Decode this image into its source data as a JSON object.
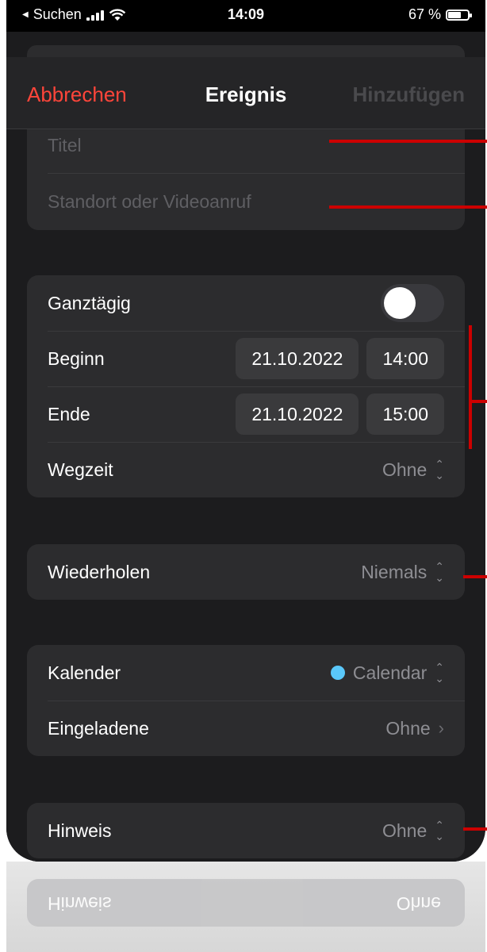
{
  "status_bar": {
    "carrier": "Suchen",
    "time": "14:09",
    "battery": "67 %"
  },
  "nav": {
    "cancel": "Abbrechen",
    "title": "Ereignis",
    "add": "Hinzufügen"
  },
  "details": {
    "title_placeholder": "Titel",
    "location_placeholder": "Standort oder Videoanruf"
  },
  "time_group": {
    "all_day_label": "Ganztägig",
    "all_day_on": false,
    "start_label": "Beginn",
    "start_date": "21.10.2022",
    "start_time": "14:00",
    "end_label": "Ende",
    "end_date": "21.10.2022",
    "end_time": "15:00",
    "travel_label": "Wegzeit",
    "travel_value": "Ohne"
  },
  "repeat": {
    "label": "Wiederholen",
    "value": "Niemals"
  },
  "calendar_group": {
    "calendar_label": "Kalender",
    "calendar_value": "Calendar",
    "calendar_color": "#5ac8fa",
    "invitees_label": "Eingeladene",
    "invitees_value": "Ohne"
  },
  "alert": {
    "label": "Hinweis",
    "value": "Ohne"
  },
  "colors": {
    "accent_red": "#ff453a",
    "annotation": "#cc0000"
  }
}
